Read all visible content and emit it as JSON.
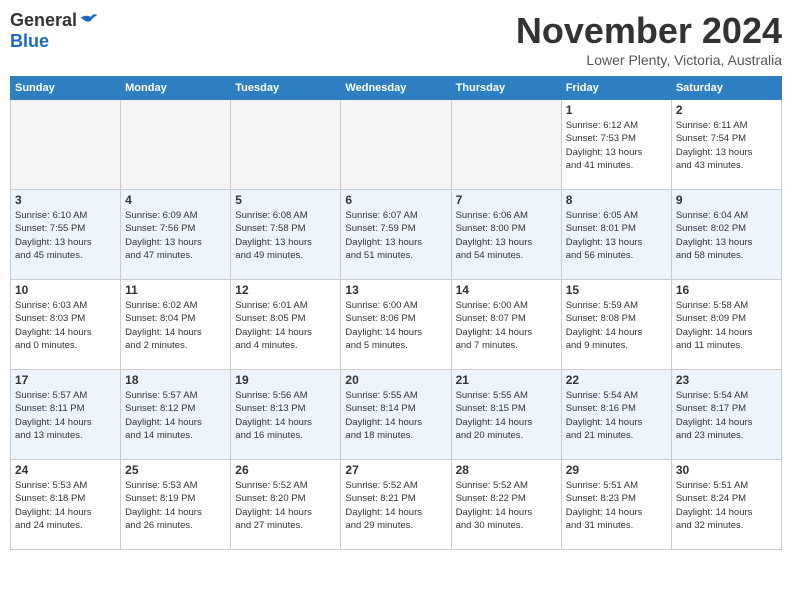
{
  "header": {
    "logo_general": "General",
    "logo_blue": "Blue",
    "month": "November 2024",
    "location": "Lower Plenty, Victoria, Australia"
  },
  "days_of_week": [
    "Sunday",
    "Monday",
    "Tuesday",
    "Wednesday",
    "Thursday",
    "Friday",
    "Saturday"
  ],
  "weeks": [
    [
      {
        "day": "",
        "info": ""
      },
      {
        "day": "",
        "info": ""
      },
      {
        "day": "",
        "info": ""
      },
      {
        "day": "",
        "info": ""
      },
      {
        "day": "",
        "info": ""
      },
      {
        "day": "1",
        "info": "Sunrise: 6:12 AM\nSunset: 7:53 PM\nDaylight: 13 hours\nand 41 minutes."
      },
      {
        "day": "2",
        "info": "Sunrise: 6:11 AM\nSunset: 7:54 PM\nDaylight: 13 hours\nand 43 minutes."
      }
    ],
    [
      {
        "day": "3",
        "info": "Sunrise: 6:10 AM\nSunset: 7:55 PM\nDaylight: 13 hours\nand 45 minutes."
      },
      {
        "day": "4",
        "info": "Sunrise: 6:09 AM\nSunset: 7:56 PM\nDaylight: 13 hours\nand 47 minutes."
      },
      {
        "day": "5",
        "info": "Sunrise: 6:08 AM\nSunset: 7:58 PM\nDaylight: 13 hours\nand 49 minutes."
      },
      {
        "day": "6",
        "info": "Sunrise: 6:07 AM\nSunset: 7:59 PM\nDaylight: 13 hours\nand 51 minutes."
      },
      {
        "day": "7",
        "info": "Sunrise: 6:06 AM\nSunset: 8:00 PM\nDaylight: 13 hours\nand 54 minutes."
      },
      {
        "day": "8",
        "info": "Sunrise: 6:05 AM\nSunset: 8:01 PM\nDaylight: 13 hours\nand 56 minutes."
      },
      {
        "day": "9",
        "info": "Sunrise: 6:04 AM\nSunset: 8:02 PM\nDaylight: 13 hours\nand 58 minutes."
      }
    ],
    [
      {
        "day": "10",
        "info": "Sunrise: 6:03 AM\nSunset: 8:03 PM\nDaylight: 14 hours\nand 0 minutes."
      },
      {
        "day": "11",
        "info": "Sunrise: 6:02 AM\nSunset: 8:04 PM\nDaylight: 14 hours\nand 2 minutes."
      },
      {
        "day": "12",
        "info": "Sunrise: 6:01 AM\nSunset: 8:05 PM\nDaylight: 14 hours\nand 4 minutes."
      },
      {
        "day": "13",
        "info": "Sunrise: 6:00 AM\nSunset: 8:06 PM\nDaylight: 14 hours\nand 5 minutes."
      },
      {
        "day": "14",
        "info": "Sunrise: 6:00 AM\nSunset: 8:07 PM\nDaylight: 14 hours\nand 7 minutes."
      },
      {
        "day": "15",
        "info": "Sunrise: 5:59 AM\nSunset: 8:08 PM\nDaylight: 14 hours\nand 9 minutes."
      },
      {
        "day": "16",
        "info": "Sunrise: 5:58 AM\nSunset: 8:09 PM\nDaylight: 14 hours\nand 11 minutes."
      }
    ],
    [
      {
        "day": "17",
        "info": "Sunrise: 5:57 AM\nSunset: 8:11 PM\nDaylight: 14 hours\nand 13 minutes."
      },
      {
        "day": "18",
        "info": "Sunrise: 5:57 AM\nSunset: 8:12 PM\nDaylight: 14 hours\nand 14 minutes."
      },
      {
        "day": "19",
        "info": "Sunrise: 5:56 AM\nSunset: 8:13 PM\nDaylight: 14 hours\nand 16 minutes."
      },
      {
        "day": "20",
        "info": "Sunrise: 5:55 AM\nSunset: 8:14 PM\nDaylight: 14 hours\nand 18 minutes."
      },
      {
        "day": "21",
        "info": "Sunrise: 5:55 AM\nSunset: 8:15 PM\nDaylight: 14 hours\nand 20 minutes."
      },
      {
        "day": "22",
        "info": "Sunrise: 5:54 AM\nSunset: 8:16 PM\nDaylight: 14 hours\nand 21 minutes."
      },
      {
        "day": "23",
        "info": "Sunrise: 5:54 AM\nSunset: 8:17 PM\nDaylight: 14 hours\nand 23 minutes."
      }
    ],
    [
      {
        "day": "24",
        "info": "Sunrise: 5:53 AM\nSunset: 8:18 PM\nDaylight: 14 hours\nand 24 minutes."
      },
      {
        "day": "25",
        "info": "Sunrise: 5:53 AM\nSunset: 8:19 PM\nDaylight: 14 hours\nand 26 minutes."
      },
      {
        "day": "26",
        "info": "Sunrise: 5:52 AM\nSunset: 8:20 PM\nDaylight: 14 hours\nand 27 minutes."
      },
      {
        "day": "27",
        "info": "Sunrise: 5:52 AM\nSunset: 8:21 PM\nDaylight: 14 hours\nand 29 minutes."
      },
      {
        "day": "28",
        "info": "Sunrise: 5:52 AM\nSunset: 8:22 PM\nDaylight: 14 hours\nand 30 minutes."
      },
      {
        "day": "29",
        "info": "Sunrise: 5:51 AM\nSunset: 8:23 PM\nDaylight: 14 hours\nand 31 minutes."
      },
      {
        "day": "30",
        "info": "Sunrise: 5:51 AM\nSunset: 8:24 PM\nDaylight: 14 hours\nand 32 minutes."
      }
    ]
  ]
}
